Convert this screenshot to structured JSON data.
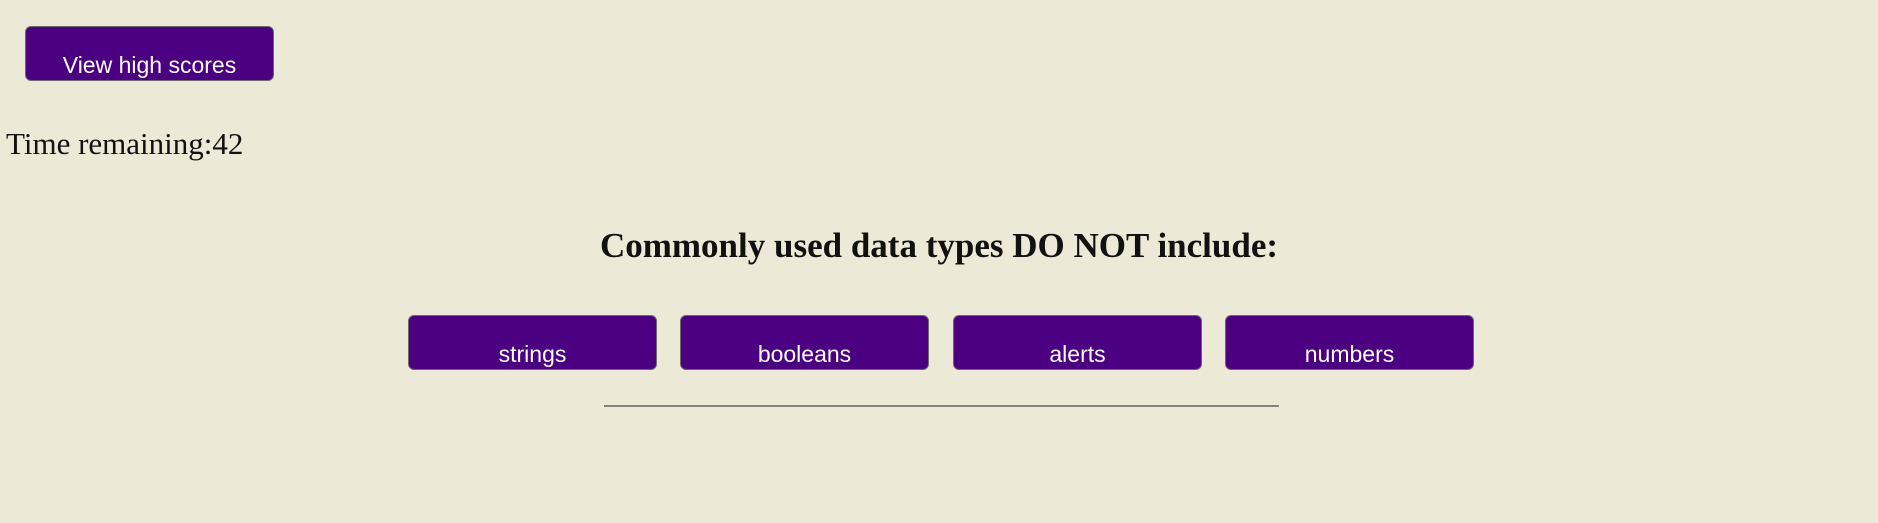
{
  "header": {
    "view_high_scores_label": "View high scores"
  },
  "timer": {
    "text": "Time remaining:42"
  },
  "question": {
    "text": "Commonly used data types DO NOT include:",
    "answers": [
      "strings",
      "booleans",
      "alerts",
      "numbers"
    ]
  },
  "colors": {
    "background": "#ece9d6",
    "button_fill": "#4b0082",
    "button_text": "#ffffff",
    "button_border": "#6a6a6a",
    "divider": "#828282"
  }
}
